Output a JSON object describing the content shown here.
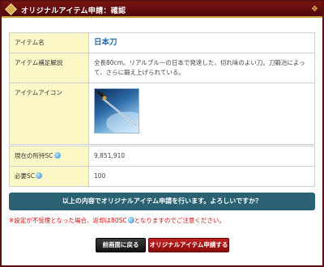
{
  "window": {
    "title": "オリジナルアイテム申請：確認"
  },
  "item": {
    "name_label": "アイテム名",
    "name": "日本刀",
    "desc_label": "アイテム補足解説",
    "description": "全長80cm。リアルブルーの日本で発達した、切れ味のよい刀。刀鍛冶によって、さらに鍛え上げられている。",
    "icon_label": "アイテムアイコン"
  },
  "sc": {
    "current_label": "現在の所持SC",
    "current_value": "9,851,910",
    "required_label": "必要SC",
    "required_value": "100"
  },
  "confirm_message": "以上の内容でオリジナルアイテム申請を行います。よろしいですか？",
  "notice": {
    "before": "※設定が不受理となった場合、返却は80SC",
    "after": "となりますのでご注意ください。"
  },
  "buttons": {
    "back": "前画面に戻る",
    "apply": "オリジナルアイテム申請する"
  },
  "colors": {
    "titlebar": "#6a1010",
    "label_bg": "#fbf7c6",
    "confirm_bar": "#2a6274",
    "apply_button": "#b01818",
    "notice_text": "#d01010"
  }
}
